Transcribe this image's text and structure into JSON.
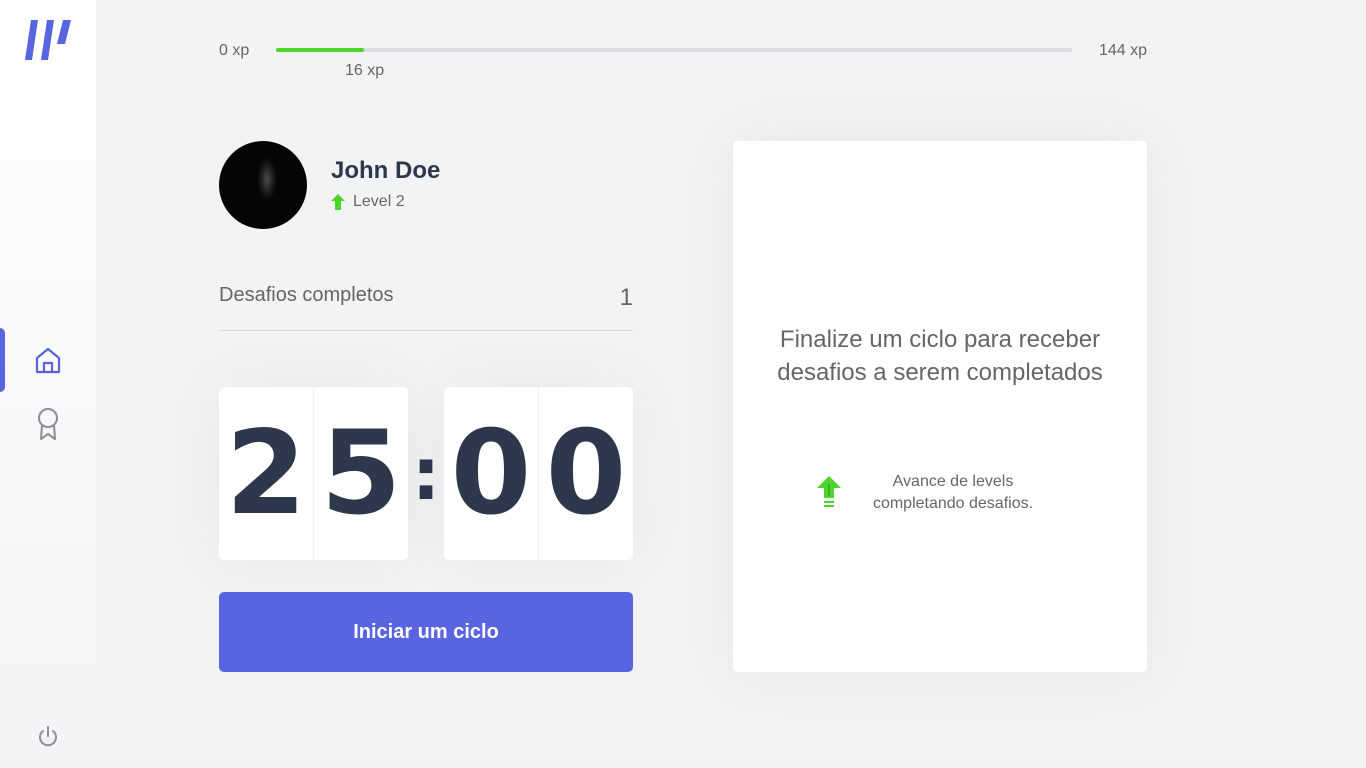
{
  "xp": {
    "min_label": "0 xp",
    "current_label": "16 xp",
    "max_label": "144 xp",
    "progress_fraction": 0.111
  },
  "profile": {
    "name": "John Doe",
    "level": "Level 2"
  },
  "completed": {
    "label": "Desafios completos",
    "count": "1"
  },
  "countdown": {
    "minute_left": "2",
    "minute_right": "5",
    "separator": ":",
    "second_left": "0",
    "second_right": "0"
  },
  "start_button": {
    "label": "Iniciar um ciclo"
  },
  "challenge": {
    "title": "Finalize um ciclo para receber desafios a serem completados",
    "hint": "Avance de levels completando desafios."
  },
  "sidebar": {
    "icons": [
      "logo-icon",
      "home-icon",
      "award-icon",
      "power-icon"
    ]
  },
  "colors": {
    "accent": "#5965e0",
    "xp_green": "#4cd62b",
    "title_dark": "#2e384d",
    "text": "#666666",
    "background": "#f2f3f5"
  }
}
